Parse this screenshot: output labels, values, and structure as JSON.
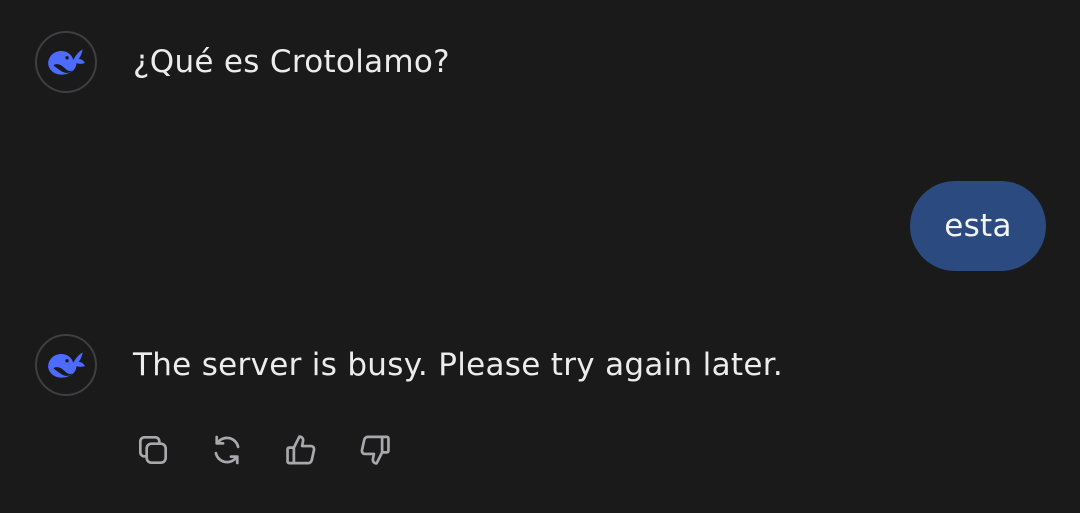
{
  "conversation": {
    "messages": [
      {
        "role": "assistant",
        "avatar_icon": "deepseek-whale-icon",
        "text": "¿Qué es Crotolamo?"
      },
      {
        "role": "user",
        "text": "esta"
      },
      {
        "role": "assistant",
        "avatar_icon": "deepseek-whale-icon",
        "text": "The server is busy. Please try again later."
      }
    ]
  },
  "message_actions": [
    {
      "icon": "copy-icon"
    },
    {
      "icon": "regenerate-icon"
    },
    {
      "icon": "thumbs-up-icon"
    },
    {
      "icon": "thumbs-down-icon"
    }
  ],
  "colors": {
    "background": "#1a1a1b",
    "text": "#ececec",
    "user_bubble": "#2b4a80",
    "brand_blue": "#4d6bfe",
    "icon_gray": "#a8a8ad"
  }
}
